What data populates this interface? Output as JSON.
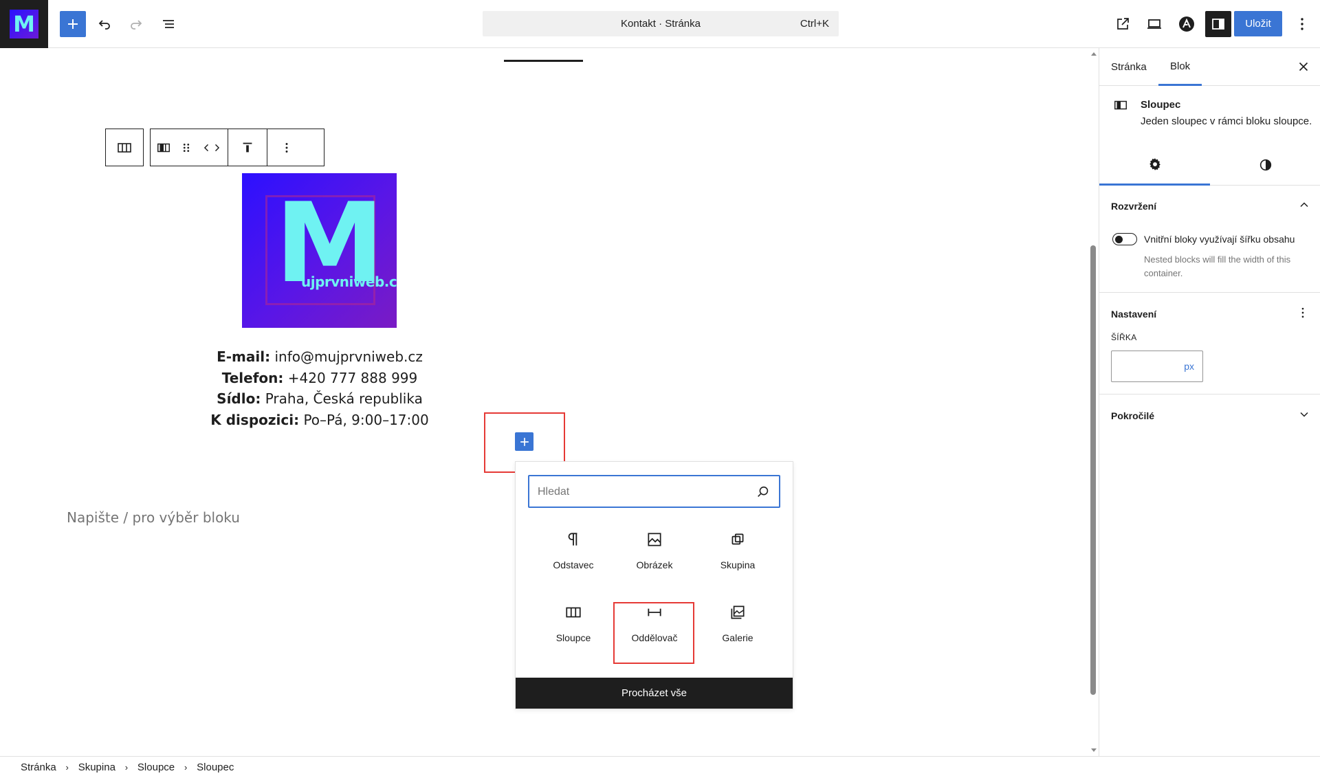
{
  "topbar": {
    "logo_letter": "M",
    "command_bar_title": "Kontakt · Stránka",
    "command_bar_shortcut": "Ctrl+K",
    "save_label": "Uložit",
    "icons": [
      "plus-icon",
      "undo-icon",
      "redo-icon",
      "list-view-icon",
      "external-link-icon",
      "desktop-preview-icon",
      "astra-icon",
      "sidebar-toggle-icon",
      "more-vertical-icon"
    ]
  },
  "canvas": {
    "logo_letter": "M",
    "logo_domain": "ujprvniweb.cz",
    "contact": [
      {
        "label": "E-mail:",
        "value": " info@mujprvniweb.cz"
      },
      {
        "label": "Telefon:",
        "value": " +420 777 888 999"
      },
      {
        "label": "Sídlo:",
        "value": " Praha, Česká republika"
      },
      {
        "label": "K dispozici:",
        "value": " Po–Pá, 9:00–17:00"
      }
    ],
    "placeholder": "Napište / pro výběr bloku"
  },
  "quick_inserter": {
    "search_placeholder": "Hledat",
    "items": [
      {
        "label": "Odstavec",
        "icon": "paragraph-icon"
      },
      {
        "label": "Obrázek",
        "icon": "image-icon"
      },
      {
        "label": "Skupina",
        "icon": "group-icon"
      },
      {
        "label": "Sloupce",
        "icon": "columns-icon"
      },
      {
        "label": "Oddělovač",
        "icon": "separator-icon"
      },
      {
        "label": "Galerie",
        "icon": "gallery-icon"
      }
    ],
    "browse_all": "Procházet vše"
  },
  "sidebar": {
    "tabs": [
      "Stránka",
      "Blok"
    ],
    "active_tab": "Blok",
    "block_title": "Sloupec",
    "block_description": "Jeden sloupec v rámci bloku sloupce.",
    "panels": {
      "layout": {
        "title": "Rozvržení",
        "toggle_label": "Vnitřní bloky využívají šířku obsahu",
        "toggle_help": "Nested blocks will fill the width of this container."
      },
      "settings": {
        "title": "Nastavení",
        "width_label": "ŠÍŘKA",
        "width_value": "",
        "width_unit": "px"
      },
      "advanced": {
        "title": "Pokročilé"
      }
    }
  },
  "breadcrumb": [
    "Stránka",
    "Skupina",
    "Sloupce",
    "Sloupec"
  ],
  "colors": {
    "accent": "#3a75d4",
    "highlight": "#e53935",
    "dark": "#1e1e1e"
  }
}
